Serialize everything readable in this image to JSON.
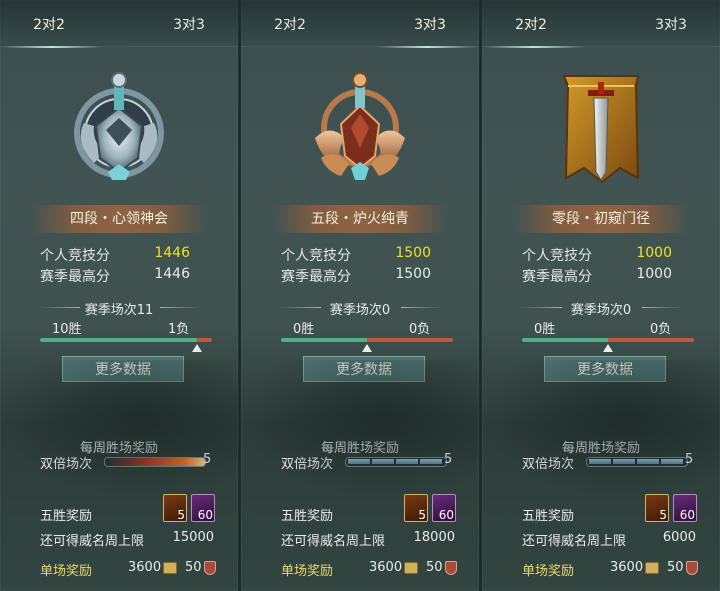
{
  "panels": [
    {
      "tab_left": "2对2",
      "tab_right": "3对3",
      "emblem": "silver-helm-emblem",
      "rank": "四段・心领神会",
      "score_label": "个人竞技分",
      "score_value": "1446",
      "best_label": "赛季最高分",
      "best_value": "1446",
      "season_label": "赛季场次11",
      "wins": "10胜",
      "losses": "1负",
      "win_ratio": 0.91,
      "more_button": "更多数据",
      "weekly_label": "每周胜场奖励",
      "double_label": "双倍场次",
      "double_value": "5",
      "double_style": "fire",
      "five_win_label": "五胜奖励",
      "item1_count": "5",
      "item2_count": "60",
      "cap_label": "还可得威名周上限",
      "cap_value": "15000",
      "single_label": "单场奖励",
      "single_coin": "3600",
      "single_shield": "50"
    },
    {
      "tab_left": "2对2",
      "tab_right": "3对3",
      "emblem": "bronze-wing-emblem",
      "rank": "五段・炉火纯青",
      "score_label": "个人竞技分",
      "score_value": "1500",
      "best_label": "赛季最高分",
      "best_value": "1500",
      "season_label": "赛季场次0",
      "wins": "0胜",
      "losses": "0负",
      "win_ratio": 0.5,
      "more_button": "更多数据",
      "weekly_label": "每周胜场奖励",
      "double_label": "双倍场次",
      "double_value": "5",
      "double_style": "segments",
      "five_win_label": "五胜奖励",
      "item1_count": "5",
      "item2_count": "60",
      "cap_label": "还可得威名周上限",
      "cap_value": "18000",
      "single_label": "单场奖励",
      "single_coin": "3600",
      "single_shield": "50"
    },
    {
      "tab_left": "2对2",
      "tab_right": "3对3",
      "emblem": "sword-banner-emblem",
      "rank": "零段・初窥门径",
      "score_label": "个人竞技分",
      "score_value": "1000",
      "best_label": "赛季最高分",
      "best_value": "1000",
      "season_label": "赛季场次0",
      "wins": "0胜",
      "losses": "0负",
      "win_ratio": 0.5,
      "more_button": "更多数据",
      "weekly_label": "每周胜场奖励",
      "double_label": "双倍场次",
      "double_value": "5",
      "double_style": "segments",
      "five_win_label": "五胜奖励",
      "item1_count": "5",
      "item2_count": "60",
      "cap_label": "还可得威名周上限",
      "cap_value": "6000",
      "single_label": "单场奖励",
      "single_coin": "3600",
      "single_shield": "50"
    }
  ],
  "colors": {
    "score_highlight": "#f0e020",
    "single_label": "#e9d96a",
    "bar_green": "#4fb08a",
    "bar_red": "#c0583c"
  }
}
